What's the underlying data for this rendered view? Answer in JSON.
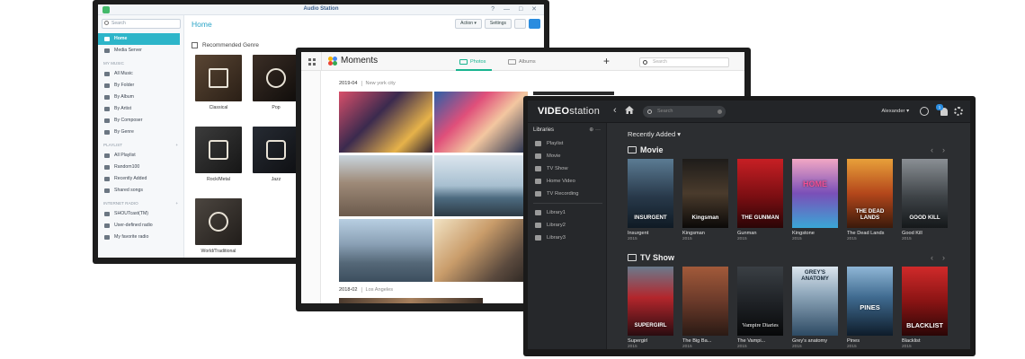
{
  "audio_station": {
    "window_title": "Audio Station",
    "search_placeholder": "Search",
    "nav_items": [
      {
        "label": "Home",
        "icon": "home-icon"
      },
      {
        "label": "Media Server",
        "icon": "server-icon"
      }
    ],
    "my_music": {
      "header": "MY MUSIC",
      "items": [
        "All Music",
        "By Folder",
        "By Album",
        "By Artist",
        "By Composer",
        "By Genre"
      ]
    },
    "playlist": {
      "header": "PLAYLIST",
      "add": "+",
      "items": [
        "All Playlist",
        "Random100",
        "Recently Added",
        "Shared songs"
      ]
    },
    "internet_radio": {
      "header": "INTERNET RADIO",
      "add": "+",
      "items": [
        "SHOUTcast(TM)",
        "User-defined radio",
        "My favorite radio"
      ]
    },
    "page_title": "Home",
    "toolbar": {
      "action_label": "Action ▾",
      "settings_label": "Settings"
    },
    "section_title": "Recommended Genre",
    "genres": [
      "Classical",
      "Pop",
      "Rock/Metal",
      "Jazz",
      "World/Traditional"
    ]
  },
  "moments": {
    "app_name": "Moments",
    "tabs": [
      {
        "label": "Photos",
        "active": true
      },
      {
        "label": "Albums",
        "active": false
      }
    ],
    "add_label": "+",
    "search_placeholder": "Search",
    "groups": [
      {
        "date": "2019-04",
        "location": "New york city"
      },
      {
        "date": "2018-02",
        "location": "Los Angeles"
      }
    ]
  },
  "video_station": {
    "logo_prefix": "VIDEO",
    "logo_suffix": "station",
    "search_placeholder": "Search",
    "user_label": "Alexander ▾",
    "notification_count": "1",
    "sidebar": {
      "header": "Libraries",
      "header_actions": "⊕  ···",
      "items": [
        "Playlist",
        "Movie",
        "TV Show",
        "Home Video",
        "TV Recording"
      ],
      "libraries": [
        "Library1",
        "Library2",
        "Library3"
      ]
    },
    "filter_label": "Recently Added ▾",
    "movie_row": {
      "title": "Movie",
      "items": [
        {
          "name": "Insurgent",
          "year": "2015",
          "poster_text": "INSURGENT"
        },
        {
          "name": "Kingsman",
          "year": "2015",
          "poster_text": "Kingsman"
        },
        {
          "name": "Gunman",
          "year": "2015",
          "poster_text": "THE GUNMAN"
        },
        {
          "name": "Kingstone",
          "year": "2015",
          "poster_text": "HOME"
        },
        {
          "name": "The Dead Lands",
          "year": "2015",
          "poster_text": "THE DEAD LANDS"
        },
        {
          "name": "Good Kill",
          "year": "2015",
          "poster_text": "GOOD KILL"
        }
      ]
    },
    "tv_row": {
      "title": "TV Show",
      "items": [
        {
          "name": "Supergirl",
          "year": "2015",
          "poster_text": "SUPERGIRL"
        },
        {
          "name": "The Big Ba...",
          "year": "2015",
          "poster_text": ""
        },
        {
          "name": "The Vampi...",
          "year": "2015",
          "poster_text": "Vampire Diaries"
        },
        {
          "name": "Grey's anatomy",
          "year": "2015",
          "poster_text": "GREY'S ANATOMY"
        },
        {
          "name": "Pines",
          "year": "2015",
          "poster_text": "PINES"
        },
        {
          "name": "Blacklist",
          "year": "2015",
          "poster_text": "BLACKLIST"
        }
      ]
    }
  },
  "colors": {
    "audio_accent": "#2db5c9",
    "moments_accent": "#17b48f",
    "video_bg": "#2c2e31"
  }
}
